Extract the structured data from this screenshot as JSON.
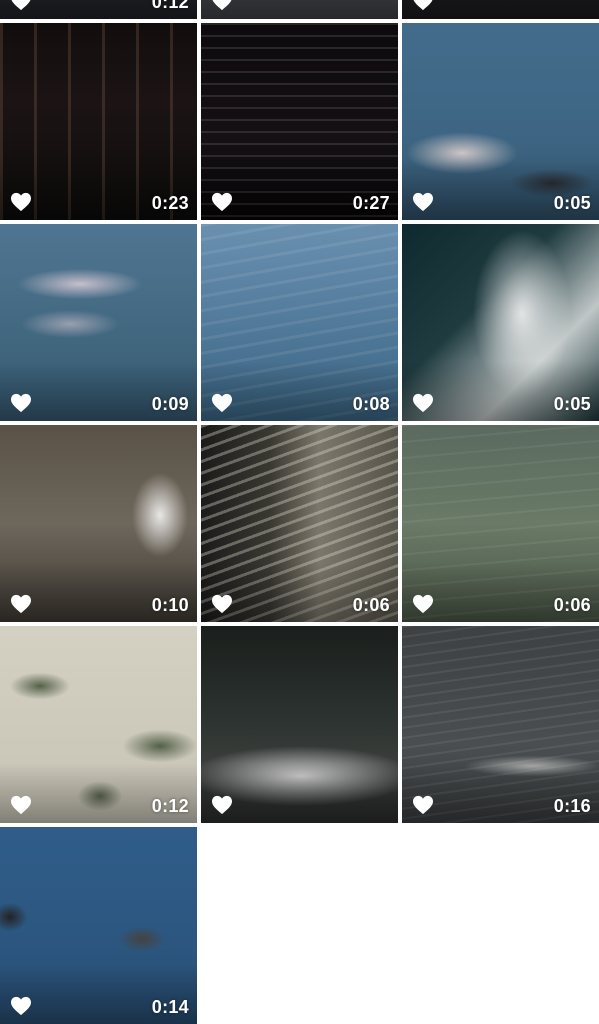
{
  "gallery": {
    "items": [
      {
        "duration": "0:12",
        "favorite_icon": "heart-icon"
      },
      {
        "duration": "",
        "favorite_icon": "heart-icon"
      },
      {
        "duration": "",
        "favorite_icon": "heart-icon"
      },
      {
        "duration": "0:23",
        "favorite_icon": "heart-icon"
      },
      {
        "duration": "0:27",
        "favorite_icon": "heart-icon"
      },
      {
        "duration": "0:05",
        "favorite_icon": "heart-icon"
      },
      {
        "duration": "0:09",
        "favorite_icon": "heart-icon"
      },
      {
        "duration": "0:08",
        "favorite_icon": "heart-icon"
      },
      {
        "duration": "0:05",
        "favorite_icon": "heart-icon"
      },
      {
        "duration": "0:10",
        "favorite_icon": "heart-icon"
      },
      {
        "duration": "0:06",
        "favorite_icon": "heart-icon"
      },
      {
        "duration": "0:06",
        "favorite_icon": "heart-icon"
      },
      {
        "duration": "0:12",
        "favorite_icon": "heart-icon"
      },
      {
        "duration": "",
        "favorite_icon": "heart-icon"
      },
      {
        "duration": "0:16",
        "favorite_icon": "heart-icon"
      },
      {
        "duration": "0:14",
        "favorite_icon": "heart-icon"
      }
    ]
  },
  "colors": {
    "background": "#ffffff",
    "overlay_text": "#ffffff"
  }
}
